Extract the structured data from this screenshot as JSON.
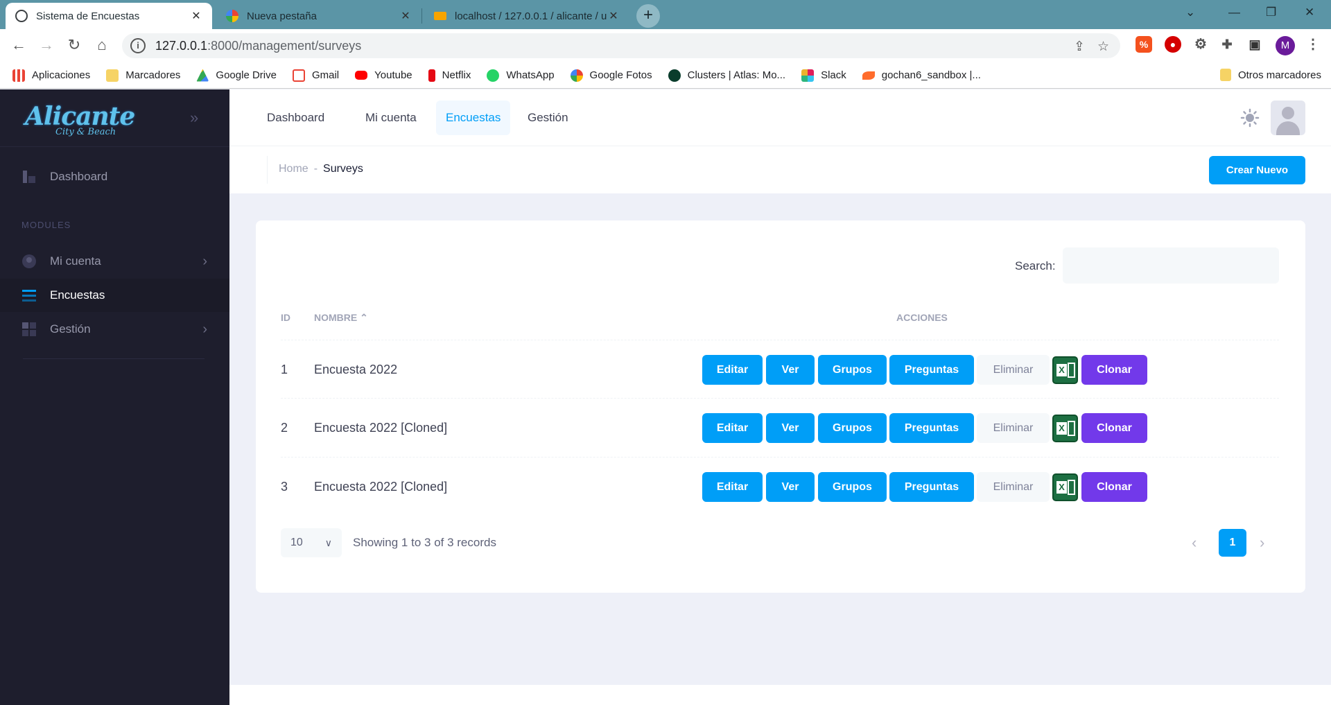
{
  "browser": {
    "tabs": [
      {
        "title": "Sistema de Encuestas",
        "active": true
      },
      {
        "title": "Nueva pestaña",
        "active": false
      },
      {
        "title": "localhost / 127.0.0.1 / alicante / u",
        "active": false
      }
    ],
    "url_host": "127.0.0.1",
    "url_path": ":8000/management/surveys",
    "profile_initial": "M",
    "bookmarks": [
      {
        "label": "Aplicaciones",
        "color": "#ea4335"
      },
      {
        "label": "Marcadores",
        "color": "#f6d365"
      },
      {
        "label": "Google Drive",
        "color": "#34a853"
      },
      {
        "label": "Gmail",
        "color": "#ea4335"
      },
      {
        "label": "Youtube",
        "color": "#ff0000"
      },
      {
        "label": "Netflix",
        "color": "#e50914"
      },
      {
        "label": "WhatsApp",
        "color": "#25d366"
      },
      {
        "label": "Google Fotos",
        "color": "#fbbc05"
      },
      {
        "label": "Clusters | Atlas: Mo...",
        "color": "#13aa52"
      },
      {
        "label": "Slack",
        "color": "#e01e5a"
      },
      {
        "label": "gochan6_sandbox |...",
        "color": "#ff6c2c"
      }
    ],
    "other_bookmarks": "Otros marcadores"
  },
  "sidebar": {
    "logo_title": "Alicante",
    "logo_subtitle": "City & Beach",
    "dashboard": "Dashboard",
    "modules_heading": "MODULES",
    "items": [
      {
        "label": "Mi cuenta",
        "has_chevron": true
      },
      {
        "label": "Encuestas",
        "active": true
      },
      {
        "label": "Gestión",
        "has_chevron": true
      }
    ]
  },
  "topnav": {
    "items": [
      "Dashboard",
      "Mi cuenta",
      "Encuestas",
      "Gestión"
    ],
    "active": "Encuestas"
  },
  "breadcrumb": {
    "home": "Home",
    "separator": "-",
    "current": "Surveys"
  },
  "toolbar": {
    "create_button": "Crear Nuevo"
  },
  "table": {
    "search_label": "Search:",
    "search_value": "",
    "headers": {
      "id": "ID",
      "name": "NOMBRE",
      "actions": "ACCIONES"
    },
    "rows": [
      {
        "id": "1",
        "name": "Encuesta 2022"
      },
      {
        "id": "2",
        "name": "Encuesta 2022 [Cloned]"
      },
      {
        "id": "3",
        "name": "Encuesta 2022 [Cloned]"
      }
    ],
    "actions": {
      "edit": "Editar",
      "view": "Ver",
      "groups": "Grupos",
      "questions": "Preguntas",
      "delete": "Eliminar",
      "clone": "Clonar",
      "export_icon": "excel-icon"
    },
    "page_size": "10",
    "info": "Showing 1 to 3 of 3 records",
    "current_page": "1"
  },
  "colors": {
    "primary": "#009ef7",
    "purple": "#7239ea",
    "sidebar": "#1e1e2d",
    "excel": "#1d6f42"
  }
}
